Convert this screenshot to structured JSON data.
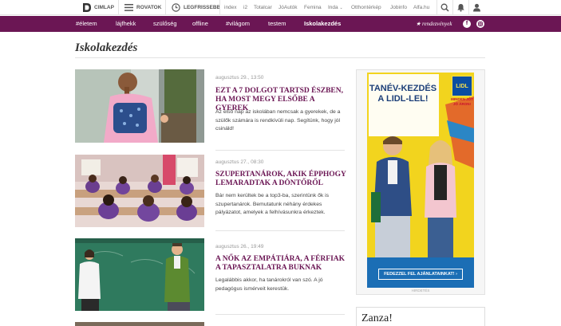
{
  "topbar": {
    "cimlap": "CIMLAP",
    "rovatok": "ROVATOK",
    "legfrissebb": "LEGFRISSEBB",
    "links": [
      "index",
      "i2",
      "Totalcar",
      "JóAutók",
      "Femina",
      "Inda",
      "Otthontérkép",
      "Jobinfo",
      "Alfa.hu"
    ]
  },
  "nav": {
    "items": [
      "#életem",
      "lájfhekk",
      "szülőség",
      "offline",
      "#világom",
      "testem",
      "Iskolakezdés"
    ],
    "active_index": 6,
    "rendezvenyek": "★ rendezvények"
  },
  "page": {
    "title": "Iskolakezdés"
  },
  "articles": [
    {
      "date": "augusztus 29., 13:50",
      "title": "Ezt a 7 dolgot tartsd észben, ha most megy elsőbe a gyerek",
      "lead": "Az első nap az iskolában nemcsak a gyerekek, de a szülők számára is rendkívüli nap. Segítünk, hogy jól csináld!"
    },
    {
      "date": "augusztus 27., 08:30",
      "title": "Szupertanárok, akik épphogy lemaradtak a döntőről",
      "lead": "Bár nem kerültek be a top3-ba, szerintünk ők is szupertanárok. Bemutatunk néhány érdekes pályázatot, amelyek a felhívásunkra érkeztek."
    },
    {
      "date": "augusztus 26., 19:49",
      "title": "A nők az empátiára, a férfiak a tapasztalatra buknak",
      "lead": "Legalábbis akkor, ha tanárokról van szó. A jó pedagógus ismérveit kerestük."
    }
  ],
  "ad": {
    "headline": "TANÉV-KEZDÉS A LIDL-LEL!",
    "brand": "LIDL",
    "slogan": "MINDEN JÓT JÓ ÁRON!",
    "cta": "FEDEZZEL FEL AJÁNLATAINKAT! ›",
    "label": "HIRDETÉS"
  },
  "zanza": {
    "title": "Zanza!"
  },
  "colors": {
    "brand_purple": "#6b1654",
    "ad_yellow": "#f2d41e",
    "ad_blue": "#1b6eb5"
  }
}
